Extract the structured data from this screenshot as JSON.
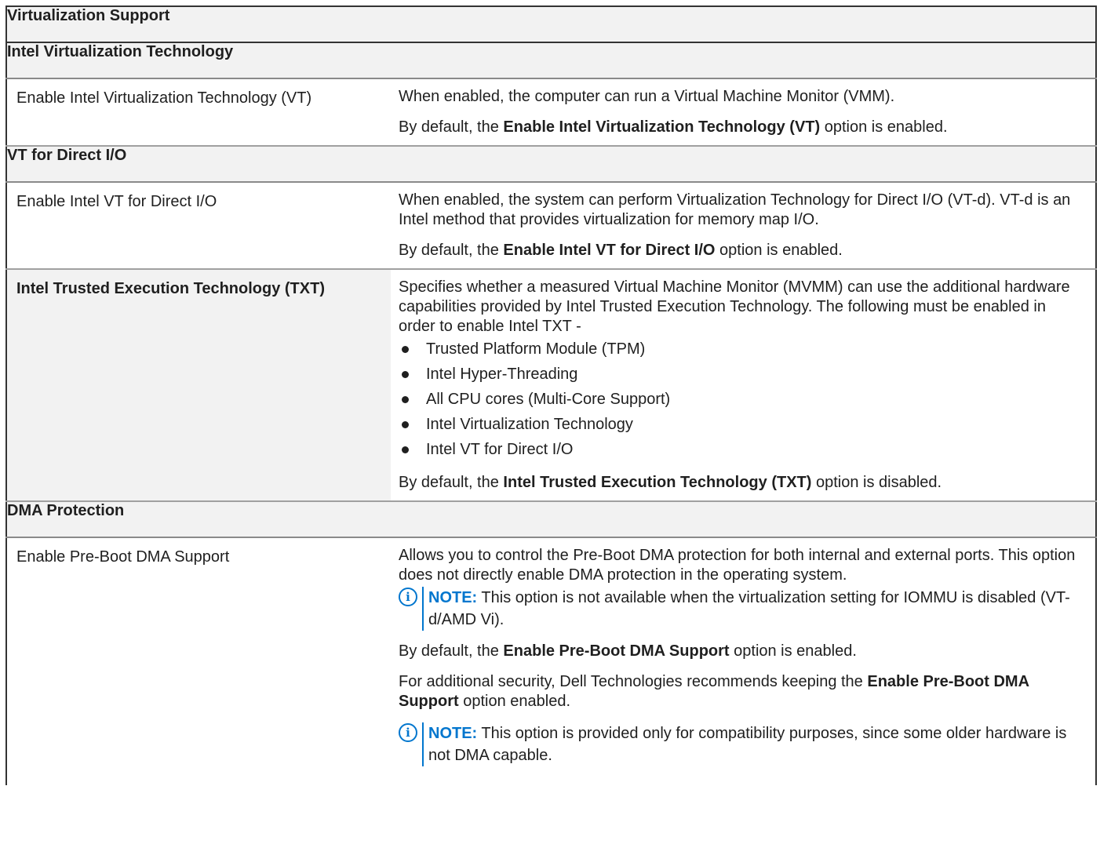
{
  "title": "Virtualization Support",
  "sections": [
    {
      "heading": "Intel Virtualization Technology",
      "option": "Enable Intel Virtualization Technology (VT)",
      "desc": "When enabled, the computer can run a Virtual Machine Monitor (VMM).",
      "default_prefix": "By default, the ",
      "default_bold": "Enable Intel Virtualization Technology (VT)",
      "default_suffix": " option is enabled."
    },
    {
      "heading": "VT for Direct I/O",
      "option": "Enable Intel VT for Direct I/O",
      "desc": "When enabled, the system can perform Virtualization Technology for Direct I/O (VT-d). VT-d is an Intel method that provides virtualization for memory map I/O.",
      "default_prefix": "By default, the ",
      "default_bold": "Enable Intel VT for Direct I/O",
      "default_suffix": " option is enabled."
    },
    {
      "option": "Intel Trusted Execution Technology (TXT)",
      "desc": "Specifies whether a measured Virtual Machine Monitor (MVMM) can use the additional hardware capabilities provided by Intel Trusted Execution Technology. The following must be enabled in order to enable Intel TXT -",
      "bullets": [
        "Trusted Platform Module (TPM)",
        "Intel Hyper-Threading",
        "All CPU cores (Multi-Core Support)",
        "Intel Virtualization Technology",
        "Intel VT for Direct I/O"
      ],
      "default_prefix": "By default, the ",
      "default_bold": "Intel Trusted Execution Technology (TXT)",
      "default_suffix": " option is disabled."
    },
    {
      "heading": "DMA Protection",
      "option": "Enable Pre-Boot DMA Support",
      "desc": "Allows you to control the Pre-Boot DMA protection for both internal and external ports. This option does not directly enable DMA protection in the operating system.",
      "note1_label": "NOTE:",
      "note1_text": " This option is not available when the virtualization setting for IOMMU is disabled (VT-d/AMD Vi).",
      "default_prefix": "By default, the ",
      "default_bold": "Enable Pre-Boot DMA Support",
      "default_suffix": " option is enabled.",
      "rec_prefix": "For additional security, Dell Technologies recommends keeping the ",
      "rec_bold": "Enable Pre-Boot DMA Support",
      "rec_suffix": " option enabled.",
      "note2_label": "NOTE:",
      "note2_text": " This option is provided only for compatibility purposes, since some older hardware is not DMA capable."
    }
  ],
  "icons": {
    "note": "info-circle-icon",
    "bullet": "bullet-dot-icon"
  },
  "colors": {
    "note_accent": "#0076ce",
    "header_bg": "#f2f2f2"
  }
}
